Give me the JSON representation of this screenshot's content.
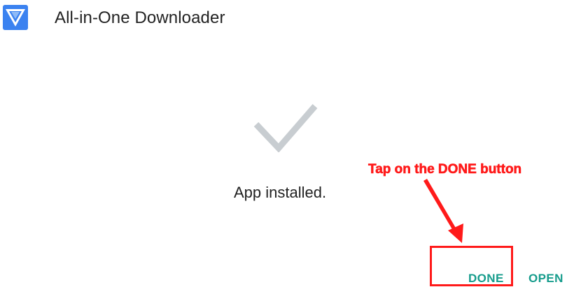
{
  "app": {
    "title": "All-in-One Downloader",
    "icon": "downloader-logo-icon"
  },
  "install": {
    "icon": "checkmark-icon",
    "status": "App installed."
  },
  "buttons": {
    "done_label": "DONE",
    "open_label": "OPEN"
  },
  "annotation": {
    "text": "Tap on the DONE button",
    "color": "#ff1a1a",
    "highlight": "done-button"
  },
  "colors": {
    "accent": "#169c8c",
    "logo": "#3b82f0",
    "check": "#c8cdd1",
    "text": "#222222"
  }
}
